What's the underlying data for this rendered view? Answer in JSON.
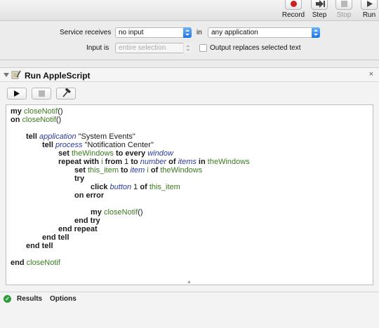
{
  "toolbar": {
    "buttons": [
      {
        "label": "Record",
        "icon": "record-icon",
        "color": "#cc1f1f",
        "enabled": true
      },
      {
        "label": "Step",
        "icon": "step-icon",
        "enabled": true
      },
      {
        "label": "Stop",
        "icon": "stop-icon",
        "enabled": false
      },
      {
        "label": "Run",
        "icon": "run-icon",
        "enabled": true
      }
    ]
  },
  "settings": {
    "service_receives_label": "Service receives",
    "input_type_value": "no input",
    "in_label": "in",
    "application_value": "any application",
    "input_is_label": "Input is",
    "input_is_value": "entire selection",
    "output_replaces_label": "Output replaces selected text",
    "output_replaces_checked": false
  },
  "action": {
    "title": "Run AppleScript",
    "close_glyph": "×",
    "toolbar_icons": [
      "play-icon",
      "stop-square-icon",
      "hammer-icon"
    ]
  },
  "code": {
    "lines": [
      {
        "indent": 0,
        "tokens": [
          [
            "kw",
            "my"
          ],
          [
            "sp",
            " "
          ],
          [
            "fn",
            "closeNotif"
          ],
          [
            "lit",
            "()"
          ]
        ]
      },
      {
        "indent": 0,
        "tokens": [
          [
            "kw",
            "on"
          ],
          [
            "sp",
            " "
          ],
          [
            "fn",
            "closeNotif"
          ],
          [
            "lit",
            "()"
          ]
        ]
      },
      {
        "indent": 0,
        "tokens": []
      },
      {
        "indent": 1,
        "tokens": [
          [
            "kw",
            "tell"
          ],
          [
            "sp",
            " "
          ],
          [
            "app",
            "application"
          ],
          [
            "lit",
            " \"System Events\""
          ]
        ]
      },
      {
        "indent": 2,
        "tokens": [
          [
            "kw",
            "tell"
          ],
          [
            "sp",
            " "
          ],
          [
            "app",
            "process"
          ],
          [
            "lit",
            " \"Notification Center\""
          ]
        ]
      },
      {
        "indent": 3,
        "tokens": [
          [
            "kw",
            "set"
          ],
          [
            "sp",
            " "
          ],
          [
            "var",
            "theWindows"
          ],
          [
            "kw",
            " to every"
          ],
          [
            "sp",
            " "
          ],
          [
            "cls",
            "window"
          ]
        ]
      },
      {
        "indent": 3,
        "tokens": [
          [
            "kw",
            "repeat with"
          ],
          [
            "sp",
            " "
          ],
          [
            "var",
            "i"
          ],
          [
            "kw",
            " from"
          ],
          [
            "lit",
            " 1 "
          ],
          [
            "kw",
            "to"
          ],
          [
            "sp",
            " "
          ],
          [
            "cls",
            "number"
          ],
          [
            "kw",
            " of"
          ],
          [
            "sp",
            " "
          ],
          [
            "cls",
            "items"
          ],
          [
            "kw",
            " in"
          ],
          [
            "sp",
            " "
          ],
          [
            "var",
            "theWindows"
          ]
        ]
      },
      {
        "indent": 4,
        "tokens": [
          [
            "kw",
            "set"
          ],
          [
            "sp",
            " "
          ],
          [
            "var",
            "this_item"
          ],
          [
            "kw",
            " to"
          ],
          [
            "sp",
            " "
          ],
          [
            "cls",
            "item"
          ],
          [
            "sp",
            " "
          ],
          [
            "var",
            "i"
          ],
          [
            "kw",
            " of"
          ],
          [
            "sp",
            " "
          ],
          [
            "var",
            "theWindows"
          ]
        ]
      },
      {
        "indent": 4,
        "tokens": [
          [
            "kw",
            "try"
          ]
        ]
      },
      {
        "indent": 5,
        "tokens": [
          [
            "kw",
            "click"
          ],
          [
            "sp",
            " "
          ],
          [
            "cls",
            "button"
          ],
          [
            "lit",
            " 1 "
          ],
          [
            "kw",
            "of"
          ],
          [
            "sp",
            " "
          ],
          [
            "var",
            "this_item"
          ]
        ]
      },
      {
        "indent": 4,
        "tokens": [
          [
            "kw",
            "on error"
          ]
        ]
      },
      {
        "indent": 0,
        "tokens": []
      },
      {
        "indent": 5,
        "tokens": [
          [
            "kw",
            "my"
          ],
          [
            "sp",
            " "
          ],
          [
            "fn",
            "closeNotif"
          ],
          [
            "lit",
            "()"
          ]
        ]
      },
      {
        "indent": 4,
        "tokens": [
          [
            "kw",
            "end try"
          ]
        ]
      },
      {
        "indent": 3,
        "tokens": [
          [
            "kw",
            "end repeat"
          ]
        ]
      },
      {
        "indent": 2,
        "tokens": [
          [
            "kw",
            "end tell"
          ]
        ]
      },
      {
        "indent": 1,
        "tokens": [
          [
            "kw",
            "end tell"
          ]
        ]
      },
      {
        "indent": 0,
        "tokens": []
      },
      {
        "indent": 0,
        "tokens": [
          [
            "kw",
            "end"
          ],
          [
            "sp",
            " "
          ],
          [
            "fn",
            "closeNotif"
          ]
        ]
      }
    ]
  },
  "bottom": {
    "results_label": "Results",
    "options_label": "Options"
  }
}
